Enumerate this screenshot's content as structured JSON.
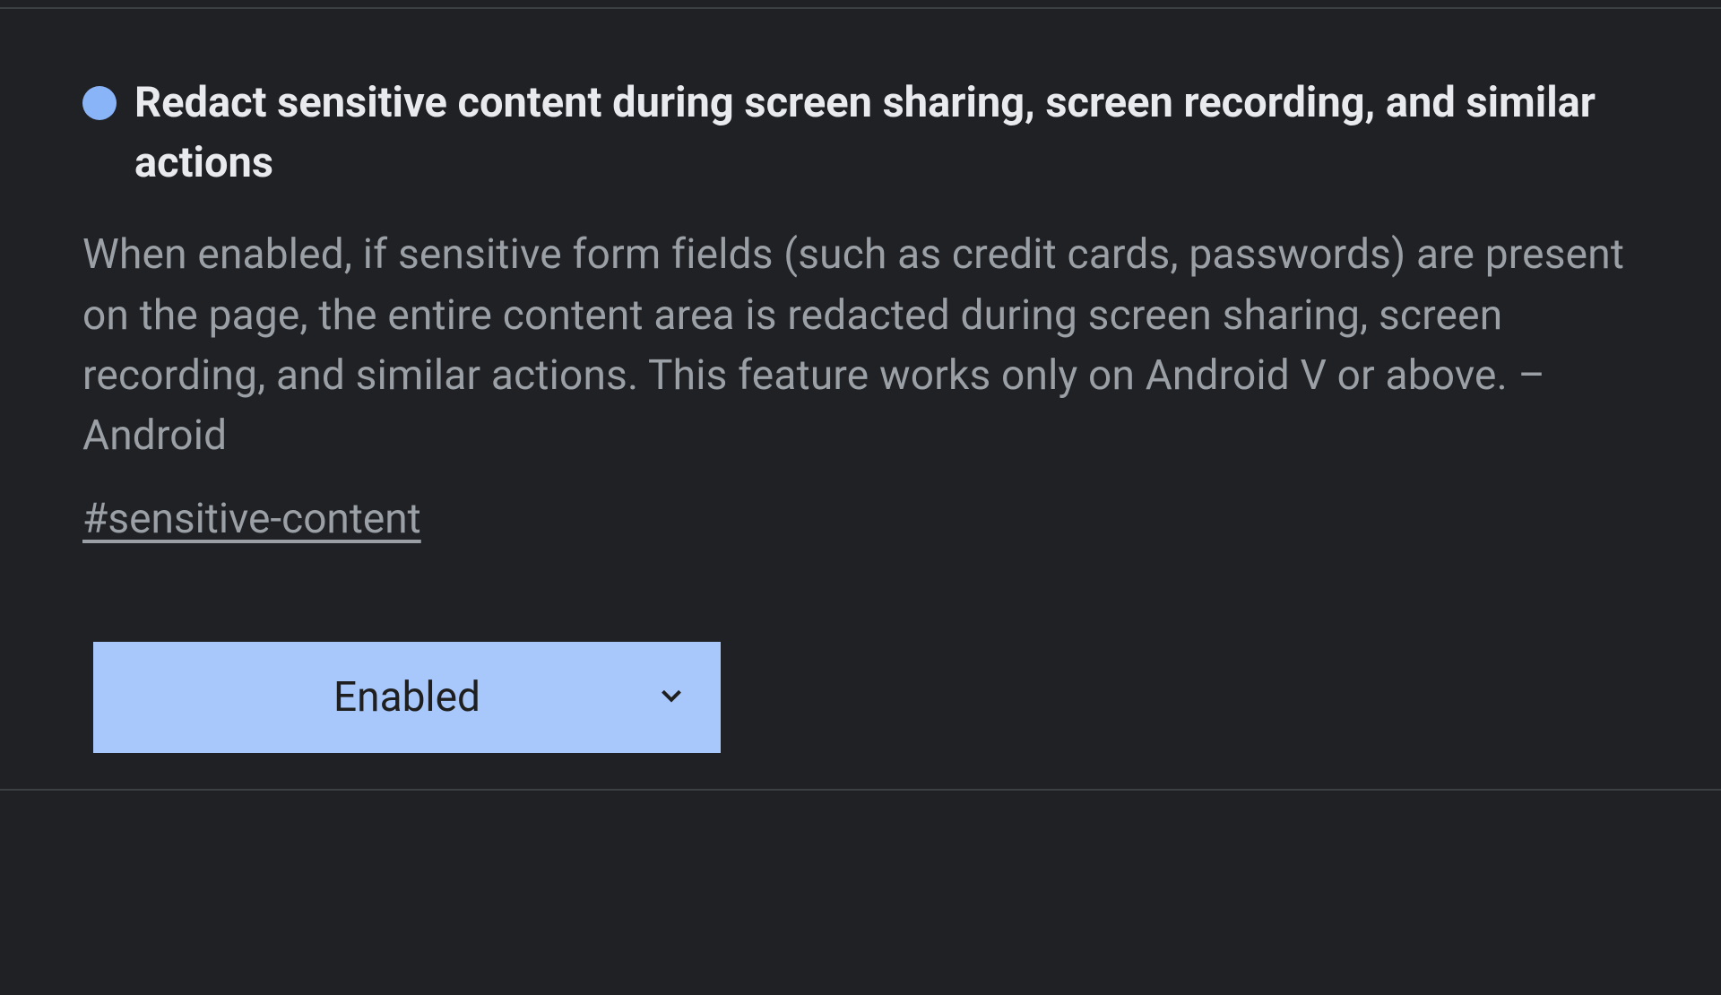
{
  "flag": {
    "title": "Redact sensitive content during screen sharing, screen recording, and similar actions",
    "description": "When enabled, if sensitive form fields (such as credit cards, passwords) are present on the page, the entire content area is redacted during screen sharing, screen recording, and similar actions. This feature works only on Android V or above. – Android",
    "hash": "#sensitive-content",
    "dropdown": {
      "selected": "Enabled"
    },
    "status_color": "#8ab4f8"
  }
}
